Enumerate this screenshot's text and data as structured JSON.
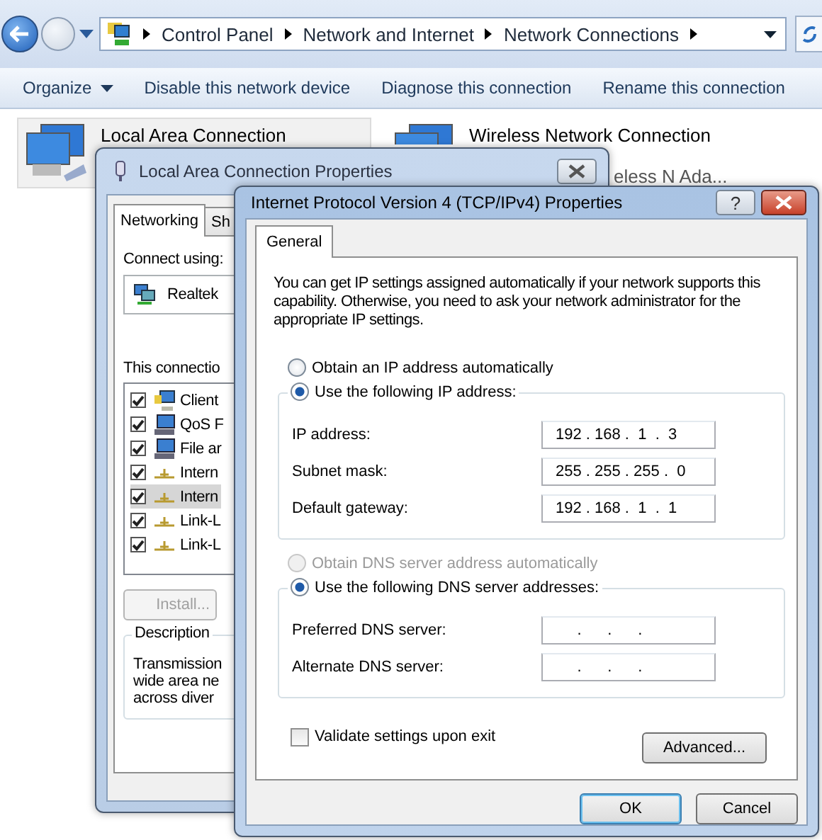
{
  "explorer": {
    "breadcrumb": [
      "Control Panel",
      "Network and Internet",
      "Network Connections"
    ],
    "commands": [
      {
        "label": "Organize",
        "kind": "menu"
      },
      {
        "label": "Disable this network device",
        "kind": "command"
      },
      {
        "label": "Diagnose this connection",
        "kind": "command"
      },
      {
        "label": "Rename this connection",
        "kind": "command"
      }
    ],
    "connections": [
      {
        "name": "Local Area Connection",
        "selected": true
      },
      {
        "name": "Wireless Network Connection",
        "detail": "eless N Ada...",
        "selected": false
      }
    ]
  },
  "lan_dialog": {
    "title": "Local Area Connection Properties",
    "tabs": [
      {
        "label": "Networking",
        "selected": true
      },
      {
        "label": "Sh",
        "selected": false
      }
    ],
    "connect_using_label": "Connect using:",
    "adapter": "Realtek",
    "items_label": "This connectio",
    "items": [
      {
        "label": "Client",
        "kind": "client",
        "checked": true,
        "selected": false
      },
      {
        "label": "QoS F",
        "kind": "service",
        "checked": true,
        "selected": false
      },
      {
        "label": "File ar",
        "kind": "service",
        "checked": true,
        "selected": false
      },
      {
        "label": "Intern",
        "kind": "protocol",
        "checked": true,
        "selected": false
      },
      {
        "label": "Intern",
        "kind": "protocol",
        "checked": true,
        "selected": true
      },
      {
        "label": "Link-L",
        "kind": "protocol",
        "checked": true,
        "selected": false
      },
      {
        "label": "Link-L",
        "kind": "protocol",
        "checked": true,
        "selected": false
      }
    ],
    "install_button": {
      "label": "Install...",
      "disabled": true
    },
    "description_title": "Description",
    "description_lines": [
      "Transmission",
      "wide area ne",
      "across diver"
    ]
  },
  "ipv4_dialog": {
    "title": "Internet Protocol Version 4 (TCP/IPv4) Properties",
    "help": "?",
    "tabs": [
      {
        "label": "General",
        "selected": true
      }
    ],
    "intro": "You can get IP settings assigned automatically if your network supports this capability. Otherwise, you need to ask your network administrator for the appropriate IP settings.",
    "ip_options": [
      {
        "label": "Obtain an IP address automatically",
        "selected": false,
        "disabled": false
      },
      {
        "label": "Use the following IP address:",
        "selected": true,
        "disabled": false
      }
    ],
    "ip_fields": [
      {
        "label": "IP address:",
        "value": "192 . 168 .  1  .  3"
      },
      {
        "label": "Subnet mask:",
        "value": "255 . 255 . 255 .  0"
      },
      {
        "label": "Default gateway:",
        "value": "192 . 168 .  1  .  1"
      }
    ],
    "dns_options": [
      {
        "label": "Obtain DNS server address automatically",
        "selected": false,
        "disabled": true
      },
      {
        "label": "Use the following DNS server addresses:",
        "selected": true,
        "disabled": false
      }
    ],
    "dns_fields": [
      {
        "label": "Preferred DNS server:",
        "value": "     .      .      ."
      },
      {
        "label": "Alternate DNS server:",
        "value": "     .      .      ."
      }
    ],
    "validate": {
      "label": "Validate settings upon exit",
      "checked": false
    },
    "advanced_button": "Advanced...",
    "buttons": [
      {
        "label": "OK",
        "default": true
      },
      {
        "label": "Cancel",
        "default": false
      }
    ]
  }
}
